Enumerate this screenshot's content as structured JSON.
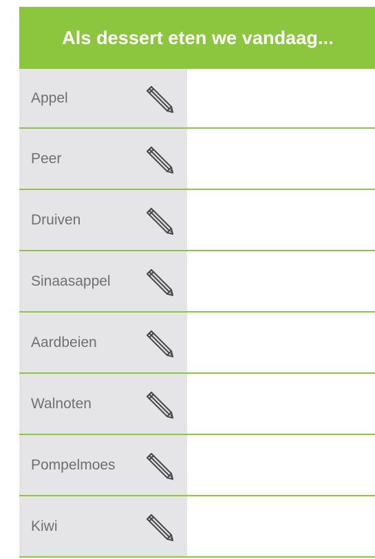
{
  "header": {
    "title": "Als dessert eten we vandaag..."
  },
  "colors": {
    "accent": "#8cc63f",
    "label_background": "#e5e5e7",
    "label_text": "#6f6f6f"
  },
  "rows": [
    {
      "label": "Appel",
      "icon": "pencil-icon"
    },
    {
      "label": "Peer",
      "icon": "pencil-icon"
    },
    {
      "label": "Druiven",
      "icon": "pencil-icon"
    },
    {
      "label": "Sinaasappel",
      "icon": "pencil-icon"
    },
    {
      "label": "Aardbeien",
      "icon": "pencil-icon"
    },
    {
      "label": "Walnoten",
      "icon": "pencil-icon"
    },
    {
      "label": "Pompelmoes",
      "icon": "pencil-icon"
    },
    {
      "label": "Kiwi",
      "icon": "pencil-icon"
    }
  ]
}
